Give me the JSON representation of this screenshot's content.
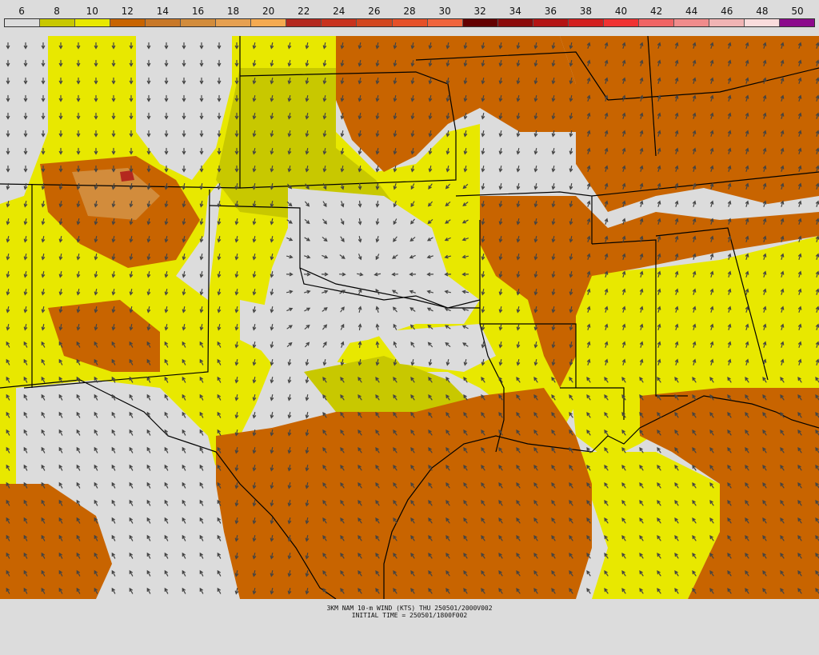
{
  "legend": {
    "labels": [
      "6",
      "8",
      "10",
      "12",
      "14",
      "16",
      "18",
      "20",
      "22",
      "24",
      "26",
      "28",
      "30",
      "32",
      "34",
      "36",
      "38",
      "40",
      "42",
      "44",
      "46",
      "48",
      "50"
    ],
    "colors": [
      "#dcdcdc",
      "#c8c800",
      "#e8e800",
      "#c86400",
      "#c87828",
      "#d28c3c",
      "#e6a050",
      "#f5aa50",
      "#b4281e",
      "#c8321e",
      "#d2461e",
      "#e65028",
      "#f0643c",
      "#640000",
      "#8c0a0a",
      "#b41414",
      "#d21e1e",
      "#f03232",
      "#f06464",
      "#f08c8c",
      "#f0b4b4",
      "#fadcdc",
      "#8c0a8c"
    ]
  },
  "map": {
    "colors": {
      "calm": "#dcdcdc",
      "olive": "#c8c800",
      "yellow": "#e8e800",
      "orange": "#c86400",
      "light_orange": "#d28c3c",
      "red": "#b4281e",
      "arrow": "#444444",
      "boundary": "#000000"
    }
  },
  "caption": {
    "line1": "3KM NAM 10-m WIND (KTS) THU 250501/2000V002",
    "line2": "INITIAL TIME = 250501/1800F002"
  }
}
